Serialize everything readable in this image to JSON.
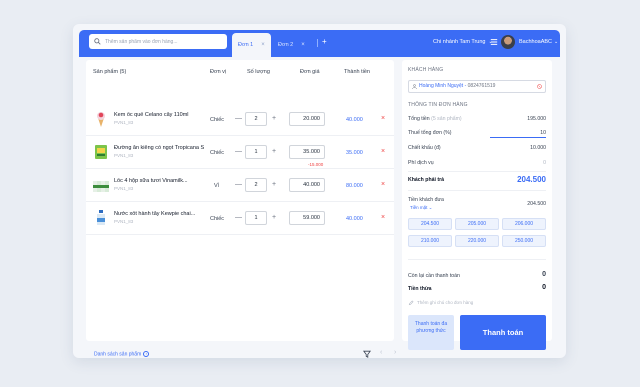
{
  "header": {
    "search_placeholder": "Thêm sản phẩm vào đơn hàng...",
    "tabs": [
      {
        "label": "Đơn 1",
        "close": "×"
      },
      {
        "label": "Đơn 2",
        "close": "×"
      }
    ],
    "add_tab": "+",
    "branch": "Chi nhánh Tam Trung",
    "user": "BachhoaABC",
    "accent": "#3b6cf5"
  },
  "table": {
    "headers": [
      "Sản phẩm (5)",
      "Đơn vị",
      "Số lượng",
      "Đơn giá",
      "Thành tiền"
    ],
    "rows": [
      {
        "name": "Kem ốc quế Celano cây 110ml",
        "sku": "PVN1_83",
        "unit": "Chiếc",
        "qty": "2",
        "price": "20.000",
        "discount": "",
        "total": "40.000"
      },
      {
        "name": "Đường ăn kiêng có ngọt Tropicana Slim...",
        "sku": "PVN1_83",
        "unit": "Chiếc",
        "qty": "1",
        "price": "35.000",
        "discount": "-15.000",
        "total": "35.000"
      },
      {
        "name": "Lốc 4 hộp sữa tươi Vinamilk...",
        "sku": "PVN1_83",
        "unit": "Vỉ",
        "qty": "2",
        "price": "40.000",
        "discount": "",
        "total": "80.000"
      },
      {
        "name": "Nước xốt hành tây Kewpie chai...",
        "sku": "PVN1_83",
        "unit": "Chiếc",
        "qty": "1",
        "price": "59.000",
        "discount": "",
        "total": "40.000"
      }
    ],
    "delete": "×",
    "minus": "—",
    "plus": "+",
    "footer_link": "Danh sách sản phẩm",
    "prev": "‹",
    "next": "›"
  },
  "customer": {
    "section_title": "KHÁCH HÀNG",
    "name": "Hoàng Minh Nguyệt",
    "phone": "0824761519"
  },
  "order": {
    "section_title": "THÔNG TIN ĐƠN HÀNG",
    "subtotal_label": "Tổng tiền",
    "subtotal_note": "(5 sản phẩm)",
    "subtotal": "195.000",
    "vat_label": "Thuế tổng đơn (%)",
    "vat": "10",
    "discount_label": "Chiết khấu (đ)",
    "discount": "10.000",
    "service_label": "Phí dịch vụ",
    "service": "0",
    "payable_label": "Khách phải trả",
    "payable": "204.500",
    "received_label": "Tiền khách đưa",
    "received": "204.500",
    "method": "Tiền mặt",
    "chips": [
      "204.500",
      "205.000",
      "206.000",
      "210.000",
      "220.000",
      "250.000"
    ],
    "remaining_label": "Còn lại cần thanh toán",
    "remaining": "0",
    "change_label": "Tiền thừa",
    "change": "0",
    "note_placeholder": "Thêm ghi chú cho đơn hàng",
    "multi_pay_label": "Thanh toán đa phương thức",
    "pay_label": "Thanh toán"
  }
}
